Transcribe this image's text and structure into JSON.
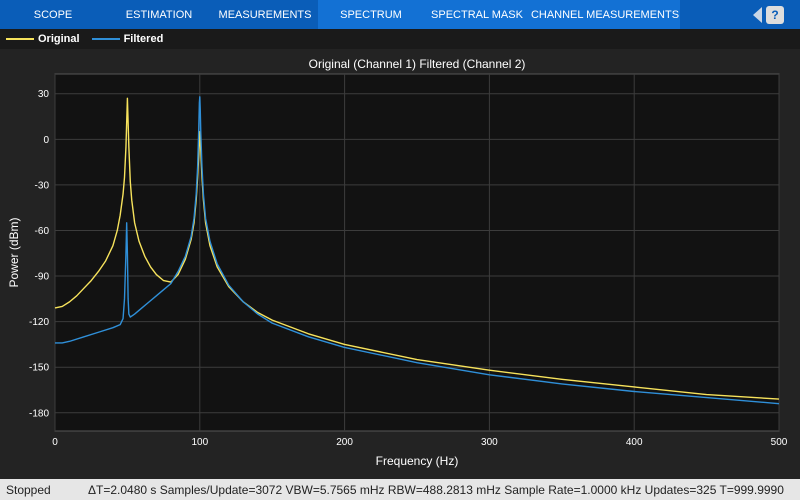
{
  "toolstrip": {
    "tabs": [
      {
        "label": "SCOPE",
        "active": false
      },
      {
        "label": "ESTIMATION",
        "active": false
      },
      {
        "label": "MEASUREMENTS",
        "active": false
      },
      {
        "label": "SPECTRUM",
        "active": true
      },
      {
        "label": "SPECTRAL MASK",
        "active": true
      },
      {
        "label": "CHANNEL MEASUREMENTS",
        "active": true
      }
    ],
    "help_label": "?"
  },
  "legend": [
    {
      "name": "Original",
      "color": "#f7e35c"
    },
    {
      "name": "Filtered",
      "color": "#2f8fd8"
    }
  ],
  "chart_data": {
    "type": "line",
    "title": "Original (Channel 1) Filtered (Channel 2)",
    "xlabel": "Frequency (Hz)",
    "ylabel": "Power (dBm)",
    "xlim": [
      0,
      500
    ],
    "ylim": [
      -192,
      43
    ],
    "xticks": [
      0,
      100,
      200,
      300,
      400,
      500
    ],
    "yticks": [
      30,
      0,
      -30,
      -60,
      -90,
      -120,
      -150,
      -180
    ],
    "grid": true,
    "series": [
      {
        "name": "Original",
        "color": "#f7e35c",
        "x": [
          0,
          5,
          10,
          15,
          20,
          25,
          30,
          35,
          40,
          43,
          45,
          47,
          48,
          49,
          50,
          51,
          52,
          53,
          55,
          58,
          62,
          66,
          70,
          75,
          80,
          85,
          90,
          94,
          96,
          97.5,
          98.5,
          99.3,
          99.7,
          100,
          100.3,
          100.7,
          101.5,
          102.5,
          104,
          107,
          112,
          120,
          130,
          140,
          150,
          175,
          200,
          250,
          300,
          350,
          400,
          450,
          500
        ],
        "y": [
          -111,
          -110,
          -107,
          -103,
          -98,
          -93,
          -87,
          -80,
          -70,
          -60,
          -50,
          -36,
          -25,
          -5,
          27,
          -5,
          -28,
          -40,
          -55,
          -67,
          -77,
          -84,
          -89,
          -93,
          -94,
          -89,
          -79,
          -66,
          -55,
          -40,
          -25,
          -10,
          0,
          5,
          0,
          -8,
          -25,
          -40,
          -55,
          -70,
          -84,
          -97,
          -107,
          -114,
          -119,
          -128,
          -135,
          -145,
          -152,
          -158,
          -163,
          -168,
          -171
        ]
      },
      {
        "name": "Filtered",
        "color": "#2f8fd8",
        "x": [
          0,
          5,
          10,
          20,
          30,
          40,
          45,
          47,
          48,
          49,
          49.5,
          50,
          50.5,
          51,
          52,
          55,
          60,
          65,
          70,
          75,
          80,
          85,
          90,
          94,
          96,
          97.5,
          98.5,
          99.3,
          99.7,
          100,
          100.3,
          100.7,
          101.5,
          102.5,
          104,
          107,
          112,
          120,
          130,
          140,
          150,
          175,
          200,
          250,
          300,
          350,
          400,
          450,
          500
        ],
        "y": [
          -134,
          -134,
          -133,
          -130,
          -127,
          -124,
          -122,
          -118,
          -105,
          -75,
          -55,
          -75,
          -105,
          -115,
          -117,
          -115,
          -111,
          -107,
          -103,
          -99,
          -95,
          -87,
          -77,
          -64,
          -52,
          -36,
          -18,
          8,
          24,
          28,
          20,
          4,
          -18,
          -36,
          -52,
          -67,
          -82,
          -96,
          -107,
          -115,
          -121,
          -130,
          -137,
          -147,
          -155,
          -161,
          -166,
          -170,
          -174
        ]
      }
    ]
  },
  "status": {
    "state": "Stopped",
    "info": "ΔT=2.0480 s  Samples/Update=3072  VBW=5.7565 mHz  RBW=488.2813 mHz  Sample Rate=1.0000 kHz  Updates=325  T=999.9990"
  }
}
